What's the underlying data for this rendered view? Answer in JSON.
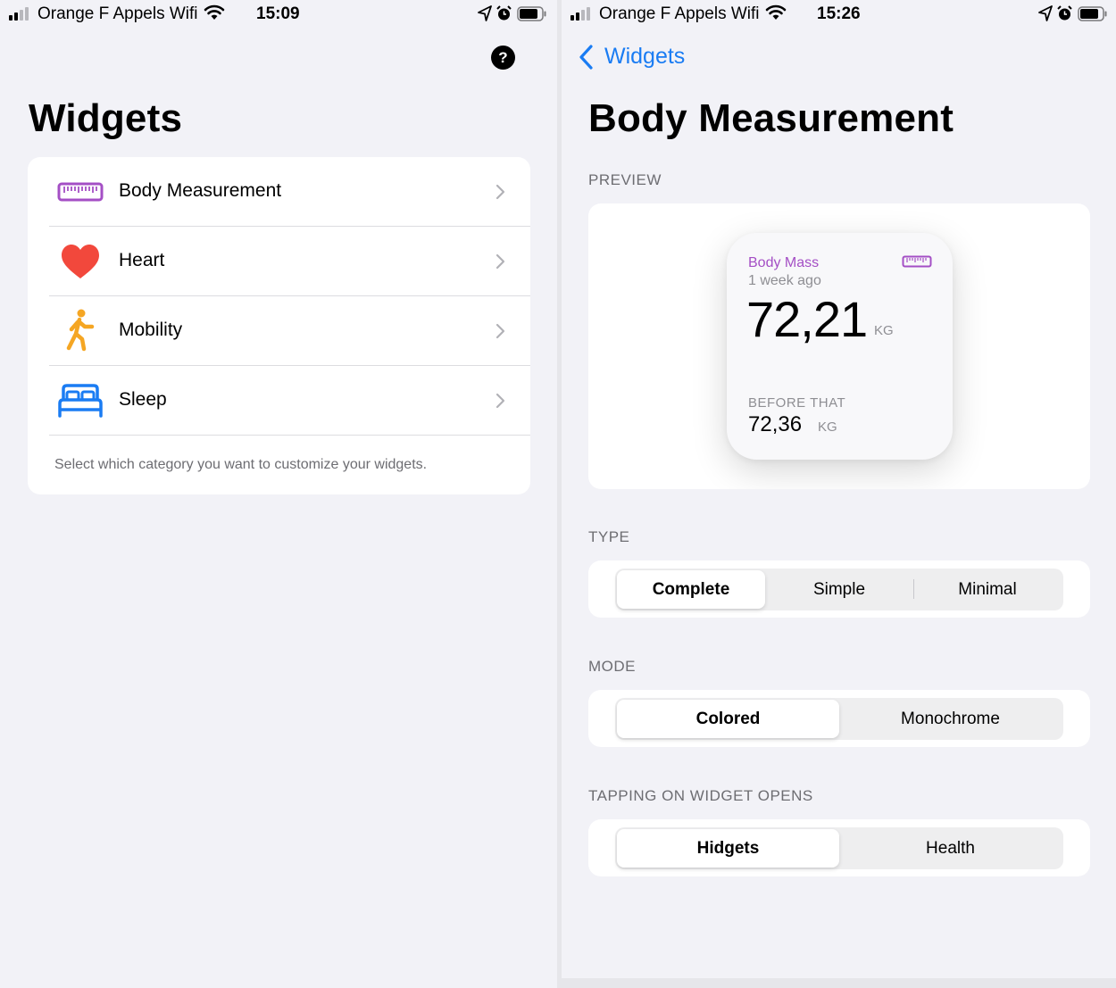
{
  "left_screen": {
    "status_bar": {
      "carrier": "Orange F Appels Wifi",
      "time": "15:09"
    },
    "help_button": "?",
    "title": "Widgets",
    "menu": {
      "items": [
        {
          "label": "Body Measurement",
          "icon": "ruler-icon",
          "color": "#a44fc5"
        },
        {
          "label": "Heart",
          "icon": "heart-icon",
          "color": "#f2483c"
        },
        {
          "label": "Mobility",
          "icon": "walking-person-icon",
          "color": "#f5a623"
        },
        {
          "label": "Sleep",
          "icon": "bed-icon",
          "color": "#1a7cf3"
        }
      ],
      "footer": "Select which category you want to customize your widgets."
    }
  },
  "right_screen": {
    "status_bar": {
      "carrier": "Orange F Appels Wifi",
      "time": "15:26"
    },
    "back_label": "Widgets",
    "title": "Body Measurement",
    "preview": {
      "header": "PREVIEW",
      "widget": {
        "title": "Body Mass",
        "subtitle": "1 week ago",
        "value": "72,21",
        "unit": "KG",
        "previous_label": "BEFORE THAT",
        "previous_value": "72,36",
        "previous_unit": "KG",
        "accent_color": "#a44fc5"
      }
    },
    "type": {
      "header": "TYPE",
      "options": [
        "Complete",
        "Simple",
        "Minimal"
      ],
      "selected": "Complete"
    },
    "mode": {
      "header": "MODE",
      "options": [
        "Colored",
        "Monochrome"
      ],
      "selected": "Colored"
    },
    "tap_action": {
      "header": "TAPPING ON WIDGET OPENS",
      "options": [
        "Hidgets",
        "Health"
      ],
      "selected": "Hidgets"
    }
  },
  "colors": {
    "accent_blue": "#1a7cf3",
    "background": "#f2f2f7",
    "secondary_text": "#6d6d72"
  }
}
